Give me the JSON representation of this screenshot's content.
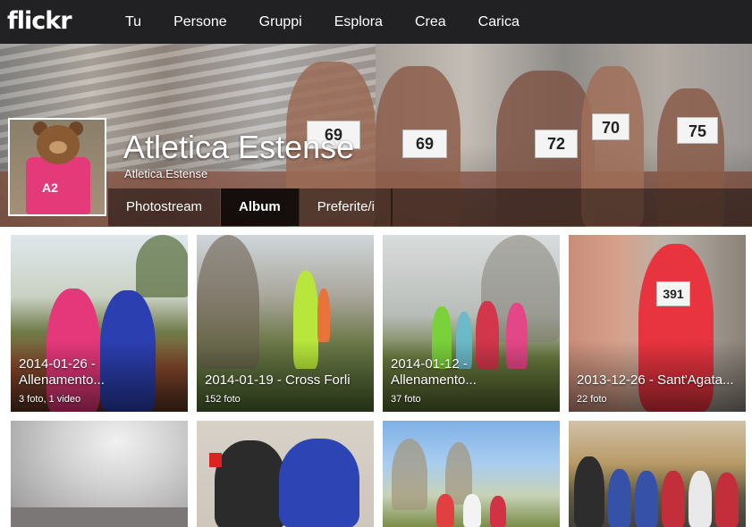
{
  "nav": {
    "logo": "flickr",
    "items": [
      "Tu",
      "Persone",
      "Gruppi",
      "Esplora",
      "Crea",
      "Carica"
    ]
  },
  "header": {
    "title": "Atletica Estense",
    "subtitle": "Atletica.Estense",
    "bibs": [
      "69",
      "72",
      "70",
      "75"
    ],
    "avatar_text": "A2",
    "tabs": [
      {
        "label": "Photostream",
        "active": false
      },
      {
        "label": "Album",
        "active": true
      },
      {
        "label": "Preferite/i",
        "active": false
      }
    ]
  },
  "albums": [
    {
      "title": "2014-01-26 - Allenamento...",
      "count": "3 foto, 1 video",
      "bib": ""
    },
    {
      "title": "2014-01-19 - Cross Forli",
      "count": "152 foto",
      "bib": ""
    },
    {
      "title": "2014-01-12 - Allenamento...",
      "count": "37 foto",
      "bib": ""
    },
    {
      "title": "2013-12-26 - Sant'Agata...",
      "count": "22 foto",
      "bib": "391"
    },
    {
      "title": "",
      "count": "",
      "bib": ""
    },
    {
      "title": "",
      "count": "",
      "bib": ""
    },
    {
      "title": "",
      "count": "",
      "bib": ""
    },
    {
      "title": "",
      "count": "",
      "bib": ""
    }
  ],
  "colors": {
    "nav_bg": "#212124",
    "accent_pink": "#e43a79"
  }
}
